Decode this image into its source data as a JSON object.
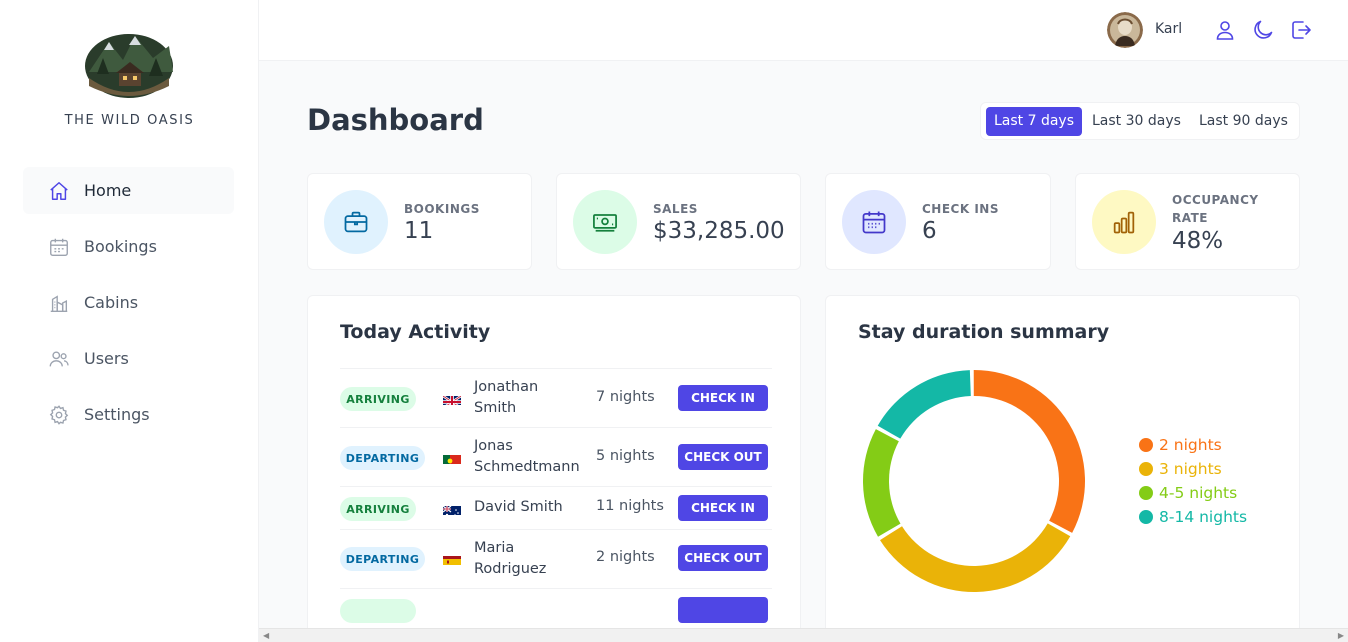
{
  "sidebar": {
    "brand": "THE WILD OASIS",
    "items": [
      {
        "label": "Home",
        "icon": "home-icon",
        "active": true
      },
      {
        "label": "Bookings",
        "icon": "calendar-icon",
        "active": false
      },
      {
        "label": "Cabins",
        "icon": "cabin-icon",
        "active": false
      },
      {
        "label": "Users",
        "icon": "users-icon",
        "active": false
      },
      {
        "label": "Settings",
        "icon": "gear-icon",
        "active": false
      }
    ]
  },
  "header": {
    "username": "Karl",
    "icons": [
      "user-icon",
      "moon-icon",
      "logout-icon"
    ]
  },
  "main": {
    "title": "Dashboard",
    "filters": [
      {
        "label": "Last 7 days",
        "active": true
      },
      {
        "label": "Last 30 days",
        "active": false
      },
      {
        "label": "Last 90 days",
        "active": false
      }
    ],
    "stats": [
      {
        "label": "BOOKINGS",
        "value": "11",
        "icon": "briefcase-icon",
        "bg": "#e0f2fe",
        "fg": "#0369a1"
      },
      {
        "label": "SALES",
        "value": "$33,285.00",
        "icon": "banknotes-icon",
        "bg": "#dcfce7",
        "fg": "#15803d"
      },
      {
        "label": "CHECK INS",
        "value": "6",
        "icon": "calendar-days-icon",
        "bg": "#e0e7ff",
        "fg": "#4338ca"
      },
      {
        "label_lines": [
          "OCCUPANCY",
          "RATE"
        ],
        "value": "48%",
        "icon": "chart-bar-icon",
        "bg": "#fef9c3",
        "fg": "#a16207"
      }
    ],
    "activity": {
      "title": "Today Activity",
      "rows": [
        {
          "status": "ARRIVING",
          "flag": "gb",
          "name_lines": [
            "Jonathan",
            "Smith"
          ],
          "nights": "7 nights",
          "action": "CHECK IN"
        },
        {
          "status": "DEPARTING",
          "flag": "pt",
          "name_lines": [
            "Jonas",
            "Schmedtmann"
          ],
          "nights": "5 nights",
          "action": "CHECK OUT"
        },
        {
          "status": "ARRIVING",
          "flag": "au",
          "name_lines": [
            "David Smith"
          ],
          "nights": "11 nights",
          "action": "CHECK IN"
        },
        {
          "status": "DEPARTING",
          "flag": "es",
          "name_lines": [
            "Maria",
            "Rodriguez"
          ],
          "nights": "2 nights",
          "action": "CHECK OUT"
        }
      ]
    },
    "duration": {
      "title": "Stay duration summary",
      "chart_data": {
        "type": "pie",
        "categories": [
          "2 nights",
          "3 nights",
          "4-5 nights",
          "8-14 nights"
        ],
        "values": [
          4,
          4,
          2,
          2
        ],
        "colors": [
          "#f97316",
          "#eab308",
          "#84cc16",
          "#14b8a6"
        ],
        "legend": "right"
      }
    }
  }
}
